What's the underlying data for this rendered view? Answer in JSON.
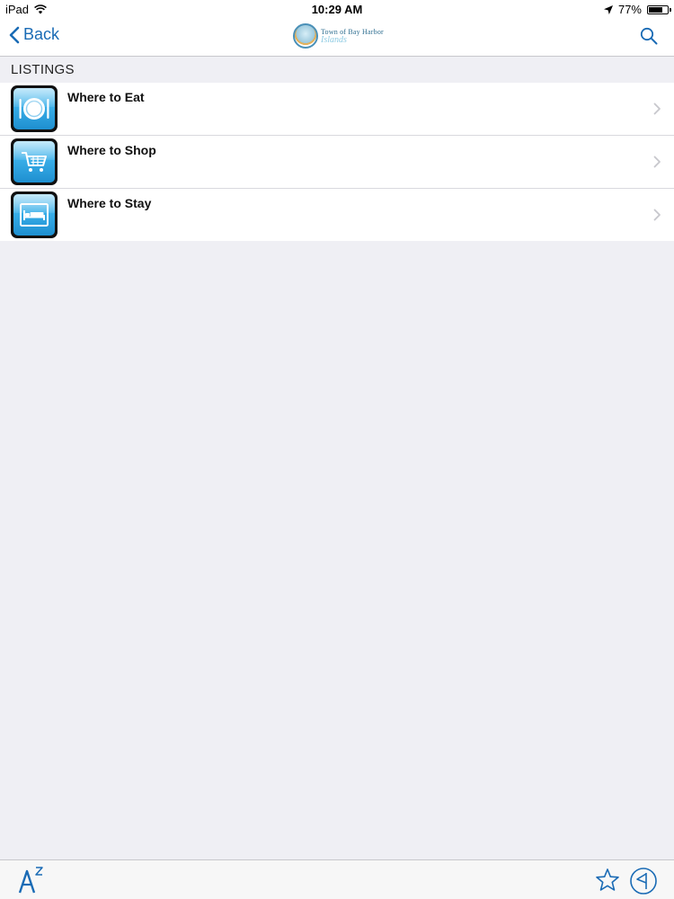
{
  "status_bar": {
    "device": "iPad",
    "time": "10:29 AM",
    "battery_percent": "77%",
    "battery_level": 0.77
  },
  "nav": {
    "back_label": "Back",
    "logo_line1": "Town of Bay Harbor",
    "logo_line2": "Islands"
  },
  "section": {
    "title": "LISTINGS"
  },
  "listings": [
    {
      "label": "Where to Eat",
      "icon": "plate-utensils-icon"
    },
    {
      "label": "Where to Shop",
      "icon": "shopping-cart-icon"
    },
    {
      "label": "Where to Stay",
      "icon": "bed-icon"
    }
  ],
  "colors": {
    "accent": "#1a6bb5",
    "background": "#efeff4",
    "icon_blue": "#39aee8"
  }
}
